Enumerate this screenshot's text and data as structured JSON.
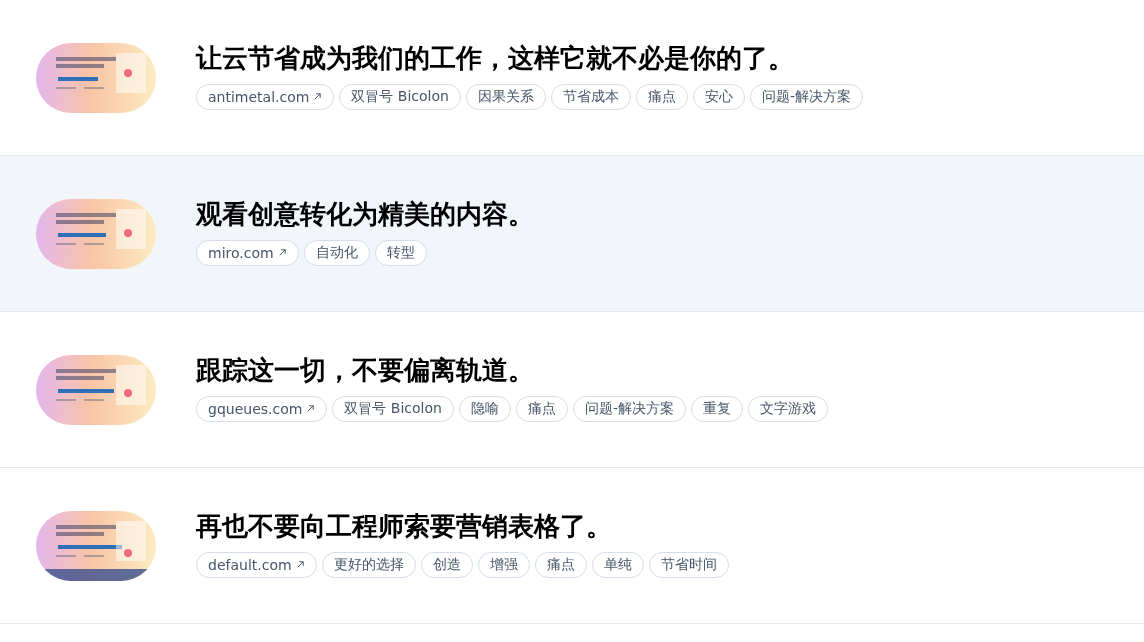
{
  "rows": [
    {
      "selected": false,
      "title": "让云节省成为我们的工作，这样它就不必是你的了。",
      "link": "antimetal.com",
      "tags": [
        "双冒号 Bicolon",
        "因果关系",
        "节省成本",
        "痛点",
        "安心",
        "问题-解决方案"
      ]
    },
    {
      "selected": true,
      "title": "观看创意转化为精美的内容。",
      "link": "miro.com",
      "tags": [
        "自动化",
        "转型"
      ]
    },
    {
      "selected": false,
      "title": "跟踪这一切，不要偏离轨道。",
      "link": "gqueues.com",
      "tags": [
        "双冒号 Bicolon",
        "隐喻",
        "痛点",
        "问题-解决方案",
        "重复",
        "文字游戏"
      ]
    },
    {
      "selected": false,
      "title": "再也不要向工程师索要营销表格了。",
      "link": "default.com",
      "tags": [
        "更好的选择",
        "创造",
        "增强",
        "痛点",
        "单纯",
        "节省时间"
      ]
    }
  ]
}
